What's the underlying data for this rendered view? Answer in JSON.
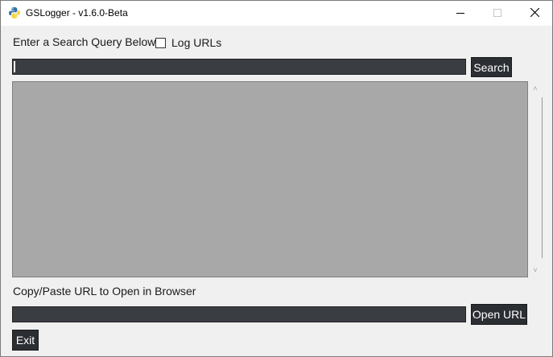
{
  "window": {
    "title": "GSLogger - v1.6.0-Beta",
    "app_icon": "python-icon",
    "controls": {
      "minimize": "minimize-icon",
      "maximize": "maximize-icon",
      "close": "close-icon"
    }
  },
  "search": {
    "prompt_label": "Enter a Search Query Below",
    "log_urls_label": "Log URLs",
    "log_urls_checked": false,
    "query_value": "",
    "search_button": "Search"
  },
  "output": {
    "text": ""
  },
  "open_url": {
    "label": "Copy/Paste URL to Open in Browser",
    "url_value": "",
    "open_button": "Open URL"
  },
  "footer": {
    "exit_button": "Exit"
  },
  "colors": {
    "input_bg": "#3a3d42",
    "button_bg": "#2b2e33",
    "output_bg": "#a8a8a8",
    "window_bg": "#f0f0f0"
  }
}
